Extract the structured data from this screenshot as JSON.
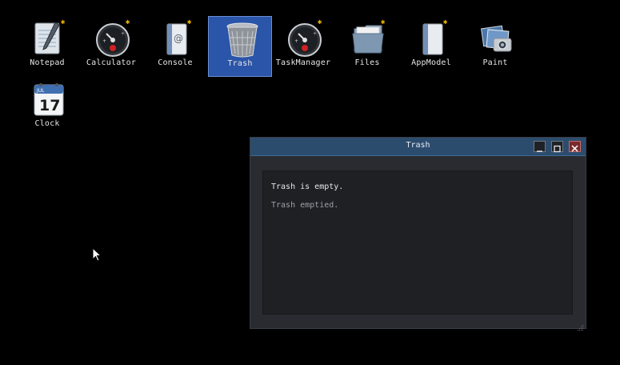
{
  "desktop": {
    "icons": [
      {
        "id": "notepad",
        "label": "Notepad",
        "icon": "notepad-icon",
        "selected": false
      },
      {
        "id": "calculator",
        "label": "Calculator",
        "icon": "calculator-icon",
        "selected": false
      },
      {
        "id": "console",
        "label": "Console",
        "icon": "console-icon",
        "selected": false
      },
      {
        "id": "trash",
        "label": "Trash",
        "icon": "trash-icon",
        "selected": true
      },
      {
        "id": "taskmanager",
        "label": "TaskManager",
        "icon": "taskmanager-icon",
        "selected": false
      },
      {
        "id": "files",
        "label": "Files",
        "icon": "folder-icon",
        "selected": false
      },
      {
        "id": "appmodel",
        "label": "AppModel",
        "icon": "document-icon",
        "selected": false
      },
      {
        "id": "paint",
        "label": "Paint",
        "icon": "paint-icon",
        "selected": false
      },
      {
        "id": "clock",
        "label": "Clock",
        "icon": "calendar-icon",
        "selected": false,
        "day": "17",
        "month": "JUL"
      }
    ]
  },
  "window": {
    "title": "Trash",
    "messages": [
      "Trash is empty.",
      "Trash emptied."
    ]
  },
  "colors": {
    "desktop_bg": "#000000",
    "titlebar": "#2c4c6e",
    "selection": "#2b55a8",
    "close_button": "#7a2a2a"
  }
}
